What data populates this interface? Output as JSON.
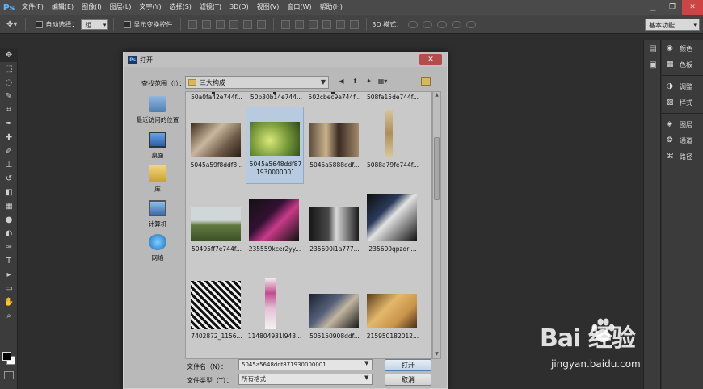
{
  "menubar": {
    "logo": "Ps",
    "items": [
      "文件(F)",
      "编辑(E)",
      "图像(I)",
      "图层(L)",
      "文字(Y)",
      "选择(S)",
      "滤镜(T)",
      "3D(D)",
      "视图(V)",
      "窗口(W)",
      "帮助(H)"
    ],
    "window_controls": [
      "▁",
      "❐",
      "✕"
    ]
  },
  "optionsbar": {
    "auto_select_label": "自动选择：",
    "auto_select_value": "组",
    "show_transform_label": "显示变换控件",
    "mode3d_label": "3D 模式：",
    "workspace_value": "基本功能"
  },
  "dock": {
    "items": [
      "颜色",
      "色板",
      "调整",
      "样式",
      "图层",
      "通道",
      "路径"
    ]
  },
  "dialog": {
    "title": "打开",
    "ps_icon": "Ps",
    "close": "✕",
    "lookin_label": "查找范围（I）：",
    "lookin_value": "三大构成",
    "places": [
      "最近访问的位置",
      "桌面",
      "库",
      "计算机",
      "网络"
    ],
    "top_row_files": [
      "50a0fa42e744f...",
      "50b30b14e744...",
      "502cbec9e744f...",
      "508fa15de744f..."
    ],
    "files": [
      "5045a59f8ddf8...",
      "5045a5648ddf87\n1930000001",
      "5045a5888ddf...",
      "5088a79fe744f...",
      "50495ff7e744f...",
      "235559kcer2yy...",
      "235600i1a777...",
      "235600qpzdrl...",
      "7402872_1156...",
      "114804931l943...",
      "505150908ddf...",
      "215950182012..."
    ],
    "filename_label": "文件名（N）：",
    "filename_value": "5045a5648ddf871930000001",
    "filetype_label": "文件类型（T）：",
    "filetype_value": "所有格式",
    "open_label": "打开",
    "cancel_label": "取消"
  },
  "watermark": {
    "logo_text": "Bai  经验",
    "url": "jingyan.baidu.com"
  }
}
